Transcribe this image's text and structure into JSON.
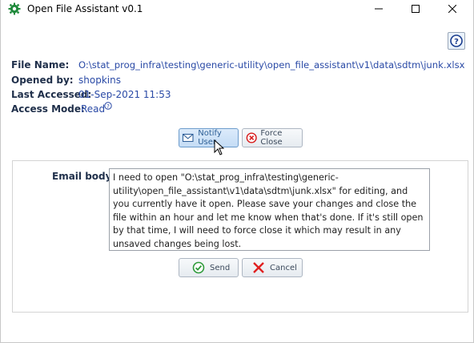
{
  "window": {
    "title": "Open File Assistant v0.1"
  },
  "file_info": {
    "file_name_label": "File Name:",
    "file_name_value": "O:\\stat_prog_infra\\testing\\generic-utility\\open_file_assistant\\v1\\data\\sdtm\\junk.xlsx",
    "opened_by_label": "Opened by:",
    "opened_by_value": "shopkins",
    "last_accessed_label": "Last Accessed:",
    "last_accessed_value": "01-Sep-2021 11:53",
    "access_mode_label": "Access Mode:",
    "access_mode_value": "Read"
  },
  "actions": {
    "notify_label": "Notify User",
    "force_close_label": "Force Close"
  },
  "email": {
    "label": "Email body:",
    "body": "I need to open \"O:\\stat_prog_infra\\testing\\generic-utility\\open_file_assistant\\v1\\data\\sdtm\\junk.xlsx\" for editing, and you currently have it open. Please save your changes and close the file within an hour and let me know when that's done. If it's still open by that time, I will need to force close it which may result in any unsaved changes being lost.",
    "send_label": "Send",
    "cancel_label": "Cancel"
  },
  "colors": {
    "value_text": "#2a4aa6",
    "label_text": "#1f2f4a",
    "send_green": "#2e9a3a",
    "cancel_red": "#e02020"
  }
}
